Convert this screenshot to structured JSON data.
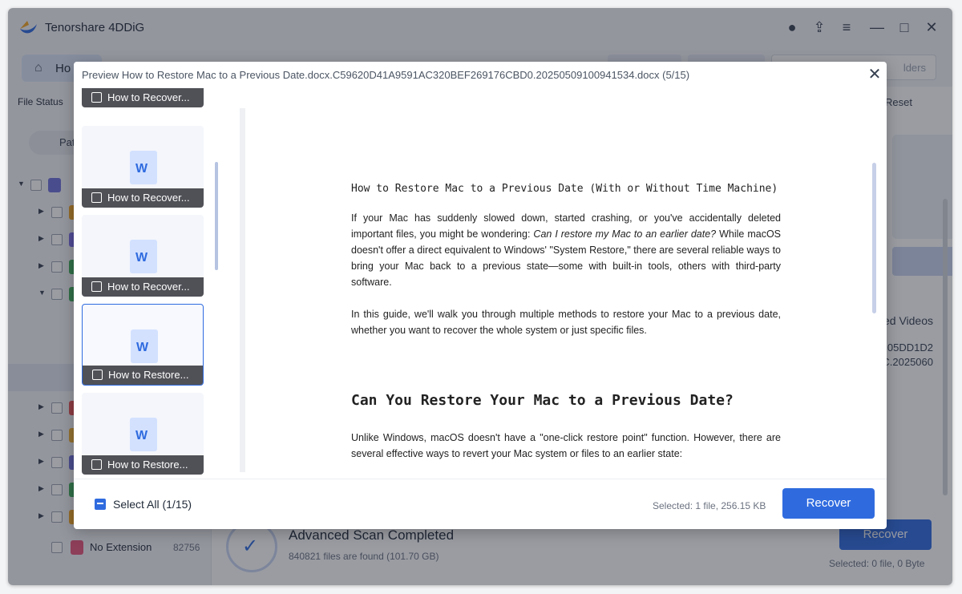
{
  "app": {
    "title": "Tenorshare 4DDiG",
    "nav_home": "Ho",
    "search_placeholder": "lders",
    "sidebar_file_status": "File Status",
    "path_label": "Pat",
    "tree_no_extension": "No Extension",
    "tree_no_extension_count": "82756",
    "reset": "Reset",
    "bg_videos": "ed Videos",
    "bg_id_line1": "05DD1D2",
    "bg_id_line2": "C.2025060",
    "scan_title": "Advanced Scan Completed",
    "scan_subtitle": "840821 files are found (101.70 GB)",
    "bg_recover": "Recover",
    "bg_selected": "Selected: 0 file, 0 Byte",
    "accent_color": "#2f6bdf"
  },
  "modal": {
    "title": "Preview How to Restore Mac to a Previous Date.docx.C59620D41A9591AC320BEF269176CBD0.20250509100941534.docx (5/15)",
    "thumbnails": [
      {
        "label": "How to Recover..."
      },
      {
        "label": "How to Recover..."
      },
      {
        "label": "How to Recover..."
      },
      {
        "label": "How to Restore..."
      },
      {
        "label": "How to Restore..."
      }
    ],
    "thumbnail_icon_letter": "W",
    "document": {
      "title": "How to Restore Mac to a Previous Date (With or Without Time Machine)",
      "para1_a": "If your Mac has suddenly slowed down, started crashing, or you've accidentally deleted important files, you might be wondering: ",
      "para1_em": "Can I restore my Mac to an earlier date?",
      "para1_b": " While macOS doesn't offer a direct equivalent to Windows' \"System Restore,\" there are several reliable ways to bring your Mac back to a previous state—some with built-in tools, others with third-party software.",
      "para2": "In this guide, we'll walk you through multiple methods to restore your Mac to a previous date, whether you want to recover the whole system or just specific files.",
      "heading2": "Can You Restore Your Mac to a Previous Date?",
      "para3": "Unlike Windows, macOS doesn't have a \"one-click restore point\" function. However, there are several effective ways to revert your Mac system or files to an earlier state:"
    },
    "select_all": "Select All (1/15)",
    "selected_info": "Selected: 1 file, 256.15 KB",
    "recover": "Recover",
    "close_icon": "✕"
  }
}
